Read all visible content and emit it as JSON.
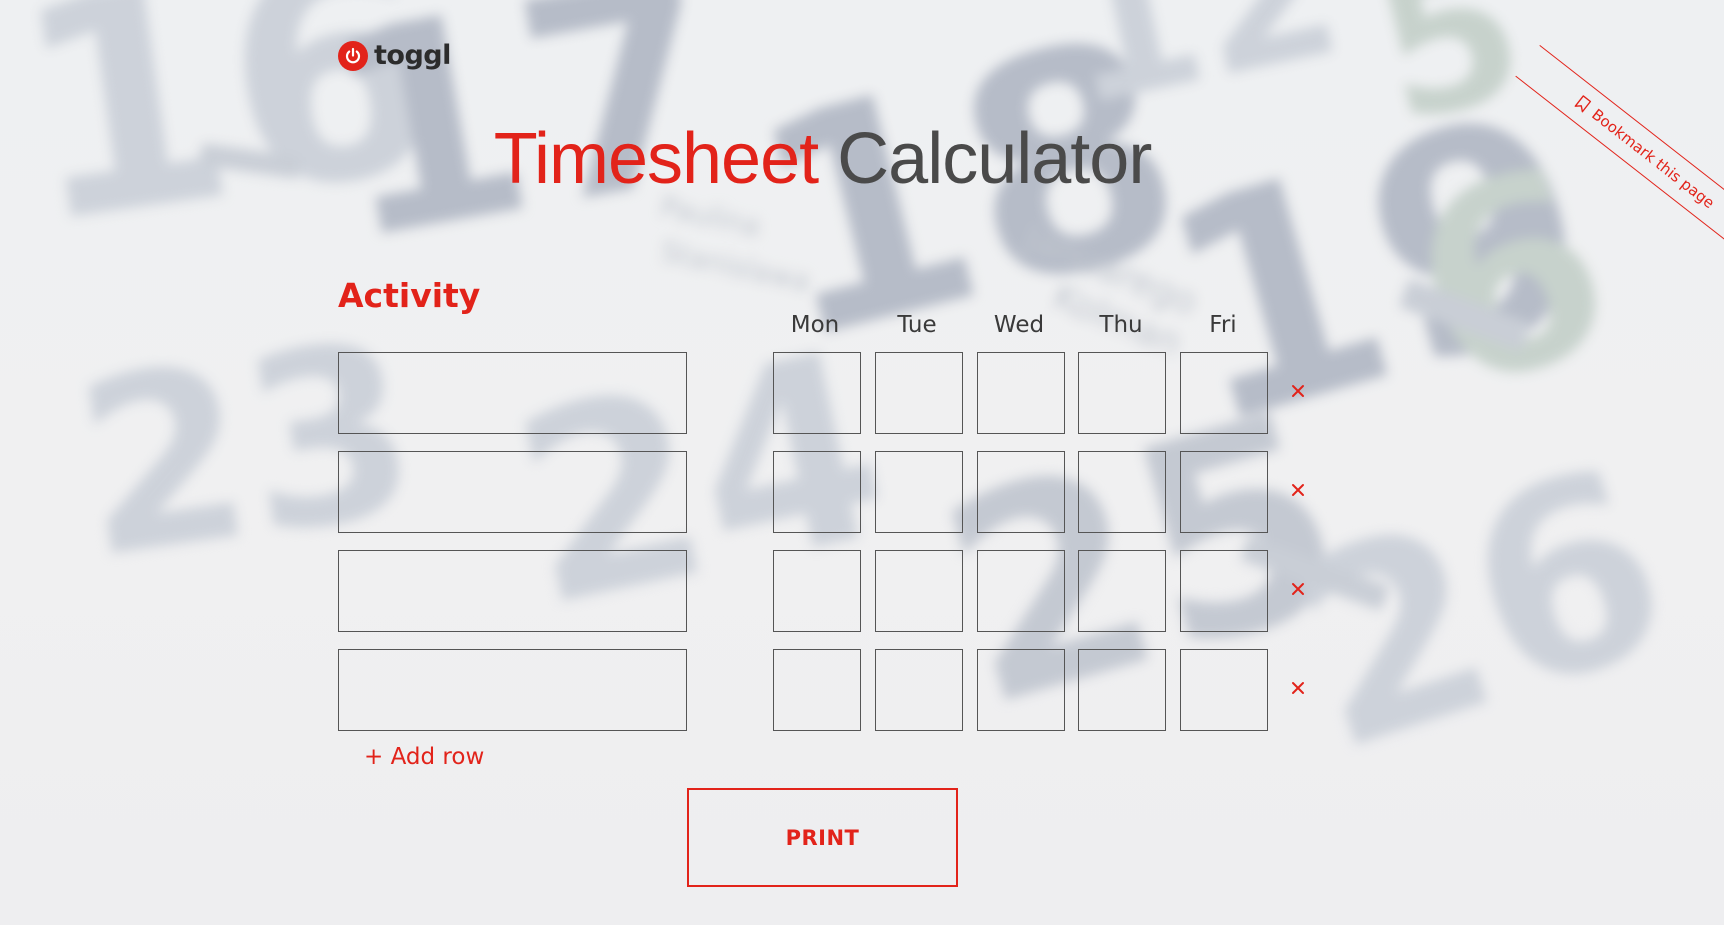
{
  "brand": {
    "name": "toggl",
    "accent": "#e2231a",
    "logo_icon": "power-icon"
  },
  "title": {
    "part1": "Timesheet",
    "part2": "Calculator"
  },
  "ribbon": {
    "label": "Bookmark this page",
    "icon": "bookmark-icon"
  },
  "activity_heading": "Activity",
  "days": [
    "Mon",
    "Tue",
    "Wed",
    "Thu",
    "Fri"
  ],
  "rows": [
    {
      "activity": "",
      "hours": [
        "",
        "",
        "",
        "",
        ""
      ]
    },
    {
      "activity": "",
      "hours": [
        "",
        "",
        "",
        "",
        ""
      ]
    },
    {
      "activity": "",
      "hours": [
        "",
        "",
        "",
        "",
        ""
      ]
    },
    {
      "activity": "",
      "hours": [
        "",
        "",
        "",
        "",
        ""
      ]
    }
  ],
  "remove_icon": "close-icon",
  "add_row_label": "+ Add row",
  "print_label": "PRINT"
}
